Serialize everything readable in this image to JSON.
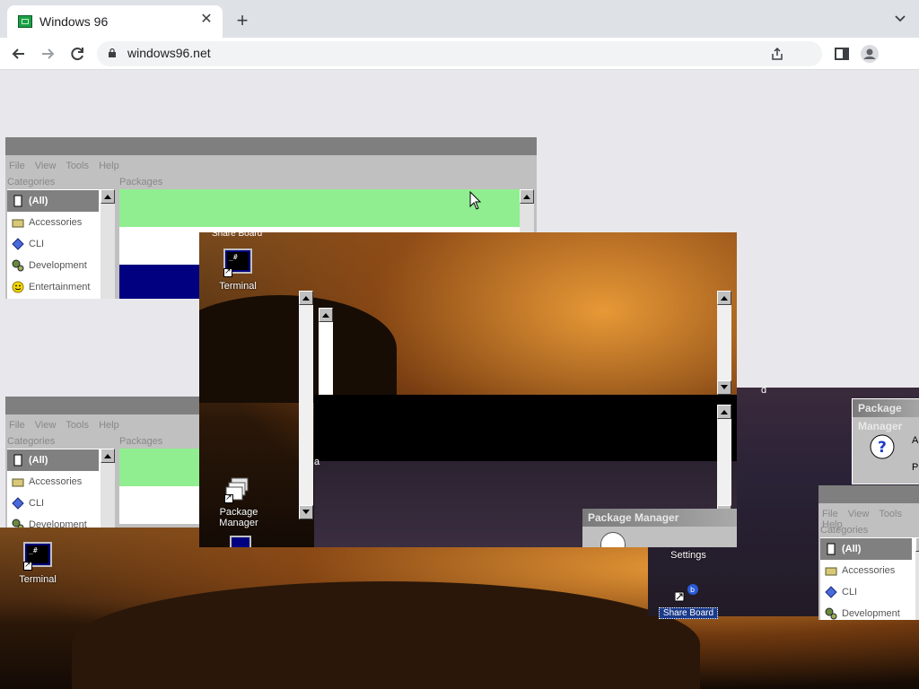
{
  "browser": {
    "tab_title": "Windows 96",
    "tab_close": "✕",
    "new_tab": "+",
    "url": "windows96.net",
    "icons": [
      "back-arrow-icon",
      "forward-arrow-icon",
      "reload-icon",
      "lock-icon",
      "share-icon",
      "side-panel-icon",
      "profile-icon",
      "tab-search-chevron-icon"
    ]
  },
  "package_manager": {
    "title": "Package Manager",
    "menu": [
      "File",
      "View",
      "Tools",
      "Help"
    ],
    "categories_label": "Categories",
    "packages_label": "Packages",
    "categories": [
      "(All)",
      "Accessories",
      "CLI",
      "Development",
      "Entertainment"
    ],
    "package_list_colors": [
      "#90ee90",
      "#ffffff",
      "#000080"
    ]
  },
  "desktop": {
    "icons": {
      "terminal": "Terminal",
      "package_manager_line1": "Package",
      "package_manager_line2": "Manager",
      "settings": "Settings",
      "share_board": "Share Board"
    },
    "stray_text": [
      "d",
      "a"
    ]
  },
  "dialog": {
    "title": "Package Manager",
    "text_fragments": [
      "A",
      "Pl"
    ],
    "icon": "question-icon"
  }
}
